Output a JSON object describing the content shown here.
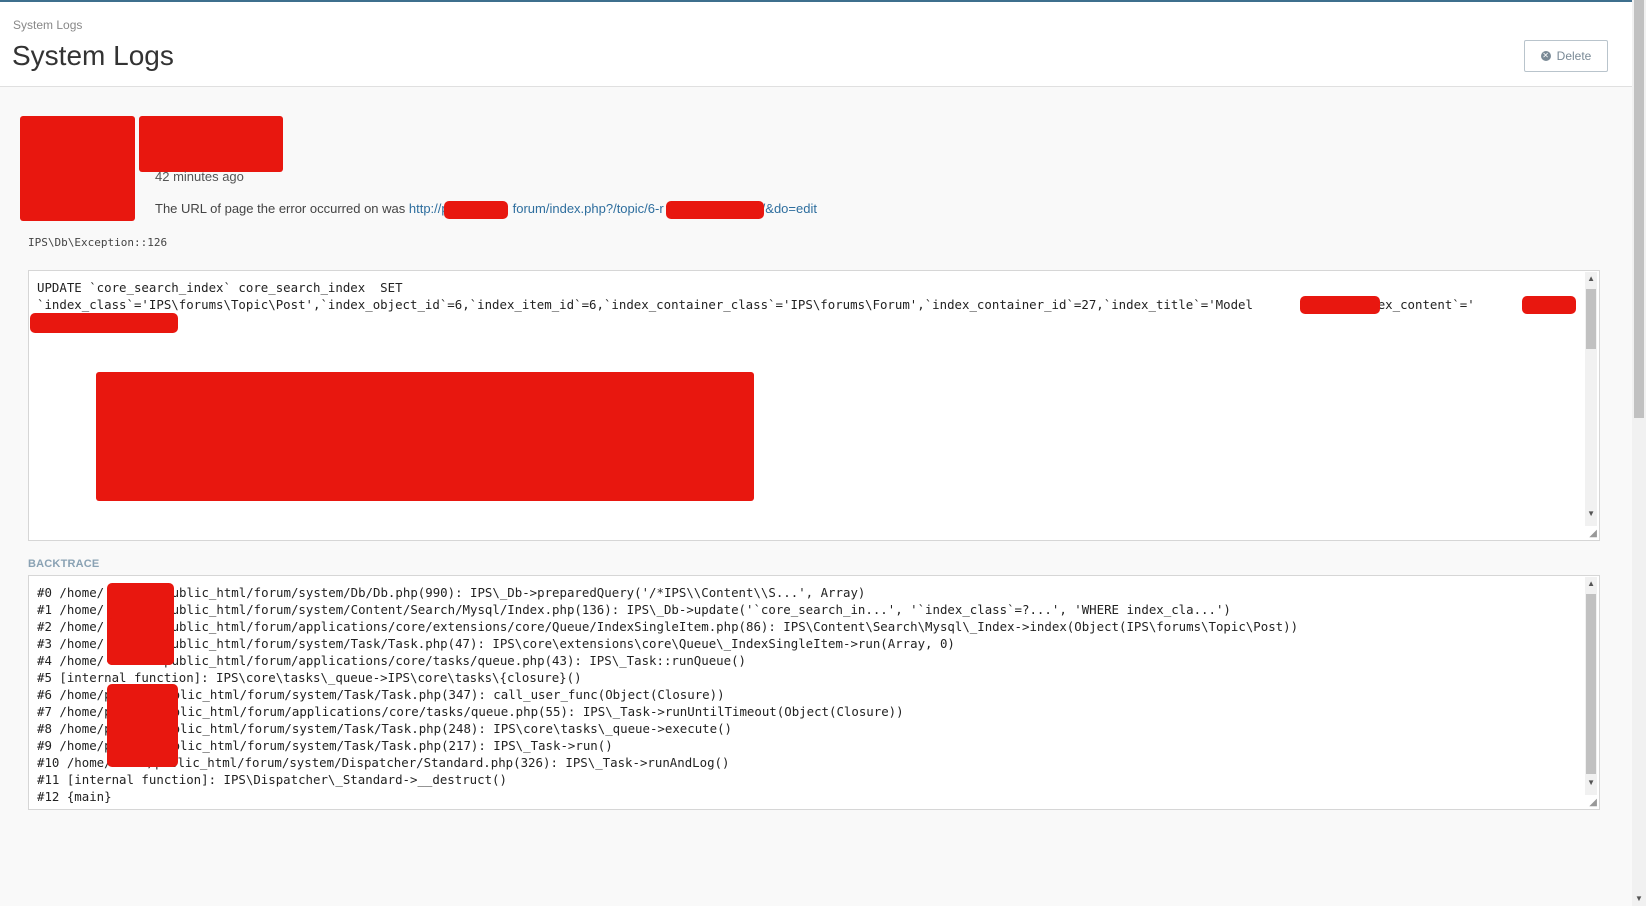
{
  "header": {
    "breadcrumb": "System Logs",
    "title": "System Logs",
    "delete_label": "Delete",
    "delete_icon": "close-circle-icon"
  },
  "log": {
    "time": "42 minutes ago",
    "url_prefix": "The URL of page the error occurred on was ",
    "url_part1": "http://p",
    "url_part2": "forum/index.php?/topic/6-r",
    "url_part3": "/&do=edit",
    "exception": "IPS\\Db\\Exception::126",
    "query_line1": "UPDATE `core_search_index` core_search_index  SET",
    "query_line2": "`index_class`='IPS\\forums\\Topic\\Post',`index_object_id`=6,`index_item_id`=6,`index_container_class`='IPS\\forums\\Forum',`index_container_id`=27,`index_title`='Model ",
    "query_line2_tail": ",`index_content`='"
  },
  "backtrace": {
    "label": "BACKTRACE",
    "lines": [
      "#0 /home/",
      "#1 /home/",
      "#2 /home/",
      "#3 /home/",
      "#4 /home/",
      "#5 [internal function]: IPS\\core\\tasks\\_queue->IPS\\core\\tasks\\{closure}()",
      "#6 /home/p",
      "#7 /home/p",
      "#8 /home/p",
      "#9 /home/p",
      "#10 /home/",
      "#11 [internal function]: IPS\\Dispatcher\\_Standard->__destruct()",
      "#12 {main}"
    ],
    "tails": [
      "public_html/forum/system/Db/Db.php(990): IPS\\_Db->preparedQuery('/*IPS\\\\Content\\\\S...', Array)",
      "public_html/forum/system/Content/Search/Mysql/Index.php(136): IPS\\_Db->update('`core_search_in...', '`index_class`=?...', 'WHERE index_cla...')",
      "public_html/forum/applications/core/extensions/core/Queue/IndexSingleItem.php(86): IPS\\Content\\Search\\Mysql\\_Index->index(Object(IPS\\forums\\Topic\\Post))",
      "public_html/forum/system/Task/Task.php(47): IPS\\core\\extensions\\core\\Queue\\_IndexSingleItem->run(Array, 0)",
      "public_html/forum/applications/core/tasks/queue.php(43): IPS\\_Task::runQueue()",
      "",
      "public_html/forum/system/Task/Task.php(347): call_user_func(Object(Closure))",
      "public_html/forum/applications/core/tasks/queue.php(55): IPS\\_Task->runUntilTimeout(Object(Closure))",
      "public_html/forum/system/Task/Task.php(248): IPS\\core\\tasks\\_queue->execute()",
      "public_html/forum/system/Task/Task.php(217): IPS\\_Task->run()",
      "/public_html/forum/system/Dispatcher/Standard.php(326): IPS\\_Task->runAndLog()",
      "",
      ""
    ]
  }
}
